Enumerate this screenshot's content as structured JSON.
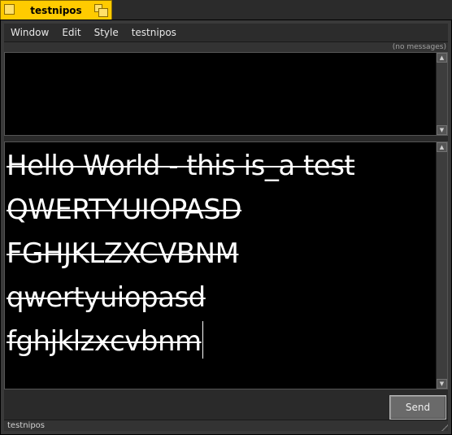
{
  "window": {
    "title": "testnipos"
  },
  "menu": {
    "items": [
      "Window",
      "Edit",
      "Style",
      "testnipos"
    ]
  },
  "log": {
    "status": "(no messages)"
  },
  "editor": {
    "lines": [
      "Hello World - this is_a test",
      "QWERTYUIOPASD",
      "FGHJKLZXCVBNM",
      "qwertyuiopasd",
      "fghjklzxcvbnm"
    ]
  },
  "send": {
    "label": "Send"
  },
  "statusbar": {
    "text": "testnipos"
  },
  "colors": {
    "titlebar": "#ffcb00",
    "background": "#000000",
    "text": "#ffffff"
  }
}
